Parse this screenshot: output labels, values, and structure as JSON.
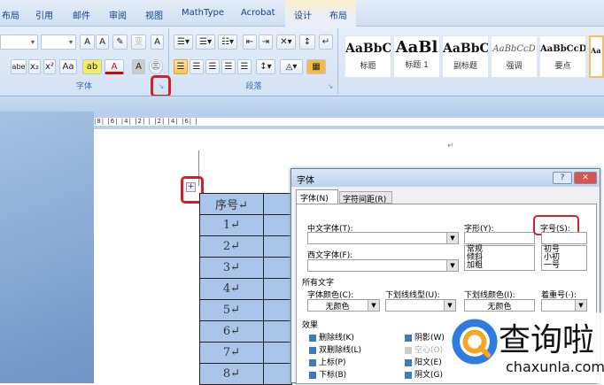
{
  "tabs": [
    "布局",
    "引用",
    "邮件",
    "审阅",
    "视图",
    "MathType",
    "Acrobat",
    "设计",
    "布局"
  ],
  "ribbon": {
    "font_group": "字体",
    "para_group": "段落",
    "font_buttons": [
      "A",
      "A",
      "A",
      "A",
      "abe",
      "x₂",
      "x²",
      "Aa",
      "A",
      "A"
    ],
    "para_buttons": [
      "☰",
      "☰",
      "☰",
      "☰",
      "☰"
    ],
    "styles": [
      {
        "preview": "AaBbC",
        "name": "标题"
      },
      {
        "preview": "AaBl",
        "name": "标题 1"
      },
      {
        "preview": "AaBbC",
        "name": "副标题"
      },
      {
        "preview": "AaBbCcD",
        "name": "强调"
      },
      {
        "preview": "AaBbCcD",
        "name": "要点"
      },
      {
        "preview": "Aa",
        "name": ""
      }
    ]
  },
  "ruler": "|8| |6| |4| |2|   | |2| |4| |6| |",
  "table": {
    "header": "序号↵",
    "rows": [
      "1↵",
      "2↵",
      "3↵",
      "4↵",
      "5↵",
      "6↵",
      "7↵",
      "8↵"
    ]
  },
  "dialog": {
    "title": "字体",
    "help": "?",
    "close": "✕",
    "tabs": [
      "字体(N)",
      "字符间距(R)"
    ],
    "cn_font_label": "中文字体(T):",
    "west_font_label": "西文字体(F):",
    "style_label": "字形(Y):",
    "style_options": [
      "常规",
      "倾斜",
      "加粗"
    ],
    "size_label": "字号(S):",
    "size_options": [
      "初号",
      "小初",
      "一号"
    ],
    "all_text": "所有文字",
    "color_label": "字体颜色(C):",
    "color_value": "无颜色",
    "underline_label": "下划线线型(U):",
    "ucolor_label": "下划线颜色(I):",
    "ucolor_value": "无颜色",
    "emphasis_label": "着重号(·):",
    "effects": "效果",
    "effects_left": [
      "删除线(K)",
      "双删除线(L)",
      "上标(P)",
      "下标(B)"
    ],
    "effects_right": [
      "阴影(W)",
      "空心(O)",
      "阳文(E)",
      "阴文(G)"
    ]
  },
  "watermark": {
    "cn": "查询啦",
    "en": "chaxunla.com"
  }
}
